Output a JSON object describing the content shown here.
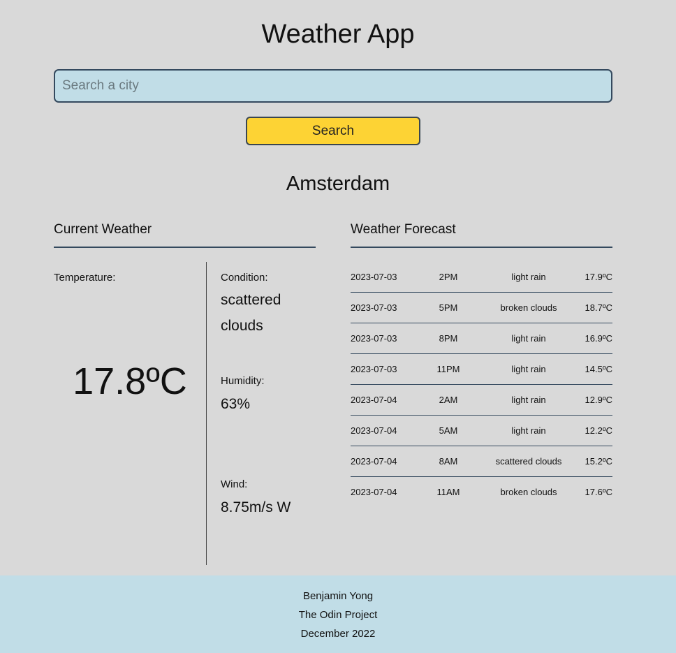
{
  "header": {
    "title": "Weather App"
  },
  "search": {
    "placeholder": "Search a city",
    "value": "",
    "button_label": "Search"
  },
  "city": "Amsterdam",
  "current": {
    "heading": "Current Weather",
    "temperature_label": "Temperature:",
    "temperature_value": "17.8ºC",
    "condition_label": "Condition:",
    "condition_value": "scattered clouds",
    "humidity_label": "Humidity:",
    "humidity_value": "63%",
    "wind_label": "Wind:",
    "wind_value": "8.75m/s W"
  },
  "forecast": {
    "heading": "Weather Forecast",
    "rows": [
      {
        "date": "2023-07-03",
        "time": "2PM",
        "condition": "light rain",
        "temp": "17.9ºC"
      },
      {
        "date": "2023-07-03",
        "time": "5PM",
        "condition": "broken clouds",
        "temp": "18.7ºC"
      },
      {
        "date": "2023-07-03",
        "time": "8PM",
        "condition": "light rain",
        "temp": "16.9ºC"
      },
      {
        "date": "2023-07-03",
        "time": "11PM",
        "condition": "light rain",
        "temp": "14.5ºC"
      },
      {
        "date": "2023-07-04",
        "time": "2AM",
        "condition": "light rain",
        "temp": "12.9ºC"
      },
      {
        "date": "2023-07-04",
        "time": "5AM",
        "condition": "light rain",
        "temp": "12.2ºC"
      },
      {
        "date": "2023-07-04",
        "time": "8AM",
        "condition": "scattered clouds",
        "temp": "15.2ºC"
      },
      {
        "date": "2023-07-04",
        "time": "11AM",
        "condition": "broken clouds",
        "temp": "17.6ºC"
      }
    ]
  },
  "footer": {
    "author": "Benjamin Yong",
    "project": "The Odin Project",
    "date": "December 2022"
  },
  "colors": {
    "background": "#d9d9d9",
    "input_bg": "#c1dde7",
    "button_bg": "#fdd334",
    "accent_border": "#34495e"
  }
}
